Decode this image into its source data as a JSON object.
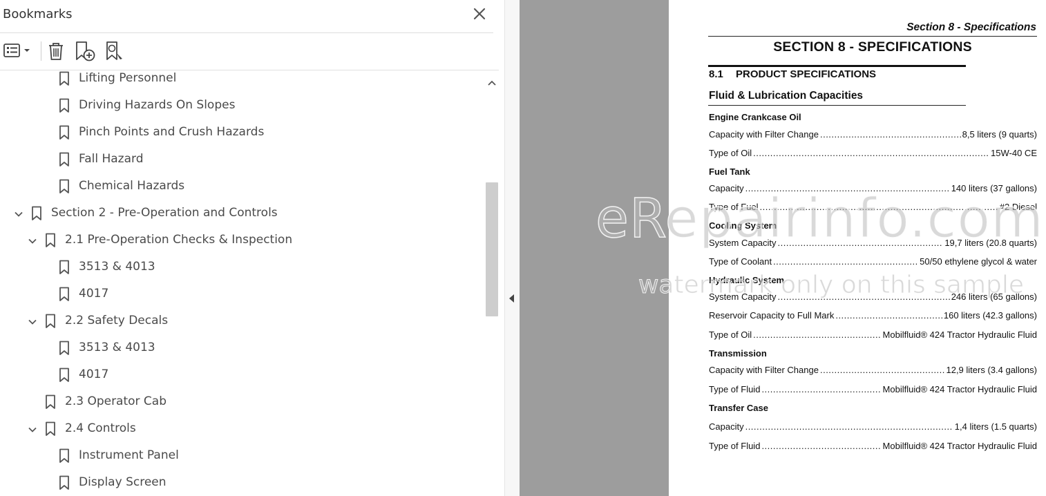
{
  "bookmarks_panel": {
    "title": "Bookmarks",
    "items": [
      {
        "label": "Lifting Personnel",
        "level": 2,
        "expanded": null
      },
      {
        "label": "Driving Hazards On Slopes",
        "level": 2,
        "expanded": null
      },
      {
        "label": "Pinch Points and Crush Hazards",
        "level": 2,
        "expanded": null
      },
      {
        "label": "Fall Hazard",
        "level": 2,
        "expanded": null
      },
      {
        "label": "Chemical Hazards",
        "level": 2,
        "expanded": null
      },
      {
        "label": "Section 2 - Pre-Operation and Controls",
        "level": 0,
        "expanded": true
      },
      {
        "label": "2.1 Pre-Operation Checks & Inspection",
        "level": 1,
        "expanded": true
      },
      {
        "label": "3513 & 4013",
        "level": 2,
        "expanded": null
      },
      {
        "label": "4017",
        "level": 2,
        "expanded": null
      },
      {
        "label": "2.2 Safety Decals",
        "level": 1,
        "expanded": true
      },
      {
        "label": "3513 & 4013",
        "level": 2,
        "expanded": null
      },
      {
        "label": "4017",
        "level": 2,
        "expanded": null
      },
      {
        "label": "2.3 Operator Cab",
        "level": 1,
        "expanded": null
      },
      {
        "label": "2.4 Controls",
        "level": 1,
        "expanded": true
      },
      {
        "label": "Instrument Panel",
        "level": 2,
        "expanded": null
      },
      {
        "label": "Display Screen",
        "level": 2,
        "expanded": null
      }
    ]
  },
  "document": {
    "running_header": "Section 8 - Specifications",
    "section_title": "SECTION 8 - SPECIFICATIONS",
    "subsection_number": "8.1",
    "subsection_title": "PRODUCT SPECIFICATIONS",
    "heading": "Fluid & Lubrication Capacities",
    "groups": [
      {
        "name": "Engine Crankcase Oil",
        "rows": [
          {
            "label": "Capacity with Filter Change",
            "value": "8,5 liters (9 quarts)"
          },
          {
            "label": "Type of Oil",
            "value": "15W-40 CE"
          }
        ]
      },
      {
        "name": "Fuel Tank",
        "rows": [
          {
            "label": "Capacity",
            "value": "140 liters (37 gallons)"
          },
          {
            "label": "Type of Fuel",
            "value": "#2 Diesel"
          }
        ]
      },
      {
        "name": "Cooling System",
        "rows": [
          {
            "label": "System Capacity",
            "value": "19,7 liters (20.8 quarts)"
          },
          {
            "label": "Type of Coolant",
            "value": "50/50 ethylene glycol & water"
          }
        ]
      },
      {
        "name": "Hydraulic System",
        "rows": [
          {
            "label": "System Capacity",
            "value": "246 liters (65 gallons)"
          },
          {
            "label": "Reservoir Capacity to Full Mark",
            "value": "160 liters (42.3 gallons)"
          },
          {
            "label": "Type of Oil",
            "value": "Mobilfluid® 424 Tractor Hydraulic Fluid"
          }
        ]
      },
      {
        "name": "Transmission",
        "rows": [
          {
            "label": "Capacity with Filter Change",
            "value": "12,9 liters (3.4 gallons)"
          },
          {
            "label": "Type of Fluid",
            "value": "Mobilfluid® 424 Tractor Hydraulic Fluid"
          }
        ]
      },
      {
        "name": "Transfer Case",
        "rows": [
          {
            "label": "Capacity",
            "value": "1,4 liters (1.5 quarts)"
          },
          {
            "label": "Type of Fluid",
            "value": "Mobilfluid® 424 Tractor Hydraulic Fluid"
          }
        ]
      }
    ]
  },
  "watermark": {
    "line1": "eRepairinfo.com",
    "line2": "watermark only on this sample"
  },
  "icons": {
    "options": "list-options-icon",
    "delete": "trash-icon",
    "new_bookmark": "new-bookmark-icon",
    "find_bookmark": "find-bookmark-icon",
    "close": "close-icon",
    "bookmark": "bookmark-icon",
    "expand": "chevron-down-icon",
    "collapse_panel": "triangle-left-icon"
  },
  "colors": {
    "gutter": "#9d9d9d",
    "text": "#4a4a4a",
    "scroll_thumb": "#cdcdcd"
  }
}
